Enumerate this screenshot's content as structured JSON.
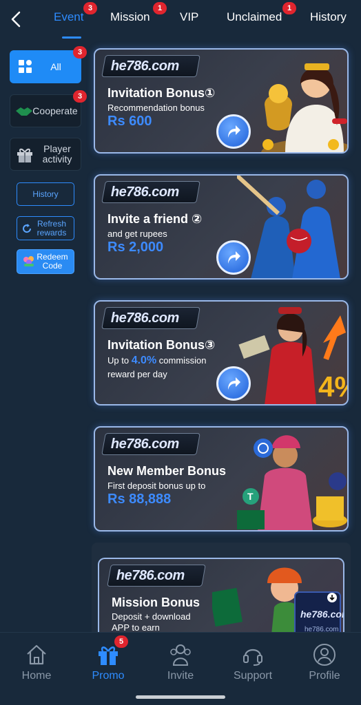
{
  "tabs": [
    {
      "label": "Event",
      "badge": "3",
      "active": true
    },
    {
      "label": "Mission",
      "badge": "1"
    },
    {
      "label": "VIP"
    },
    {
      "label": "Unclaimed",
      "badge": "1"
    },
    {
      "label": "History"
    }
  ],
  "sidebar": {
    "all": {
      "label": "All",
      "badge": "3"
    },
    "cooperate": {
      "label": "Cooperate",
      "badge": "3"
    },
    "player": {
      "label": "Player activity"
    },
    "history": {
      "label": "History"
    },
    "refresh": {
      "label": "Refresh rewards"
    },
    "redeem": {
      "label": "Redeem Code"
    }
  },
  "brand_logo": "he786.com",
  "cards": [
    {
      "title": "Invitation Bonus①",
      "subtitle": "Recommendation bonus",
      "amount": "Rs 600"
    },
    {
      "title": "Invite a friend ②",
      "subtitle": "and get rupees",
      "amount": "Rs 2,000"
    },
    {
      "title": "Invitation Bonus③",
      "sub_pre": "Up to",
      "highlight": "4.0%",
      "sub_post": "commission",
      "sub_line2": "reward per day",
      "art_text": "4%"
    },
    {
      "title": "New Member Bonus",
      "subtitle": "First deposit bonus up to",
      "amount": "Rs 88,888"
    },
    {
      "title": "Mission Bonus",
      "subtitle": "Deposit + download",
      "subtitle2": "APP to earn",
      "phone_logo": "he786.com",
      "phone_url": "he786.com"
    }
  ],
  "bottom_nav": [
    {
      "label": "Home",
      "icon": "home-icon"
    },
    {
      "label": "Promo",
      "icon": "gift-icon",
      "badge": "5",
      "active": true
    },
    {
      "label": "Invite",
      "icon": "people-icon"
    },
    {
      "label": "Support",
      "icon": "headset-icon"
    },
    {
      "label": "Profile",
      "icon": "user-icon"
    }
  ],
  "colors": {
    "background": "#18293b",
    "accent": "#2e8cff",
    "badge": "#e0252e",
    "amount": "#3d8bff"
  }
}
